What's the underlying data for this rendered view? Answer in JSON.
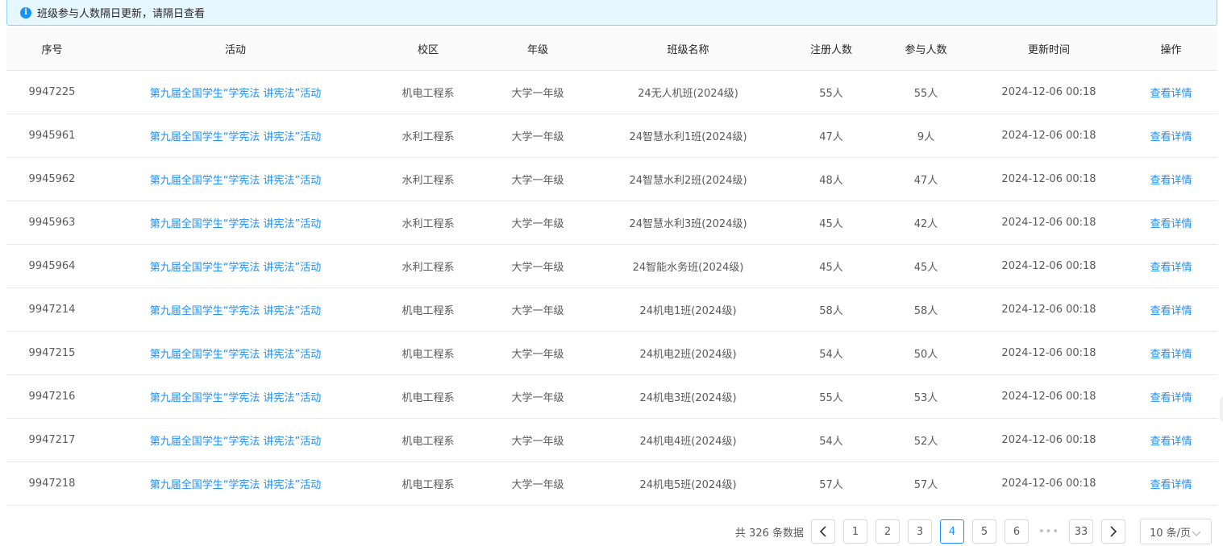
{
  "notice": {
    "text": "班级参与人数隔日更新，请隔日查看"
  },
  "table": {
    "headers": [
      "序号",
      "活动",
      "校区",
      "年级",
      "班级名称",
      "注册人数",
      "参与人数",
      "更新时间",
      "操作"
    ],
    "rows": [
      {
        "id": "9947225",
        "activity": "第九届全国学生“学宪法 讲宪法”活动",
        "campus": "机电工程系",
        "grade": "大学一年级",
        "class_name": "24无人机班(2024级)",
        "registered": "55人",
        "participants": "55人",
        "updated": "2024-12-06 00:18",
        "action": "查看详情"
      },
      {
        "id": "9945961",
        "activity": "第九届全国学生“学宪法 讲宪法”活动",
        "campus": "水利工程系",
        "grade": "大学一年级",
        "class_name": "24智慧水利1班(2024级)",
        "registered": "47人",
        "participants": "9人",
        "updated": "2024-12-06 00:18",
        "action": "查看详情"
      },
      {
        "id": "9945962",
        "activity": "第九届全国学生“学宪法 讲宪法”活动",
        "campus": "水利工程系",
        "grade": "大学一年级",
        "class_name": "24智慧水利2班(2024级)",
        "registered": "48人",
        "participants": "47人",
        "updated": "2024-12-06 00:18",
        "action": "查看详情"
      },
      {
        "id": "9945963",
        "activity": "第九届全国学生“学宪法 讲宪法”活动",
        "campus": "水利工程系",
        "grade": "大学一年级",
        "class_name": "24智慧水利3班(2024级)",
        "registered": "45人",
        "participants": "42人",
        "updated": "2024-12-06 00:18",
        "action": "查看详情"
      },
      {
        "id": "9945964",
        "activity": "第九届全国学生“学宪法 讲宪法”活动",
        "campus": "水利工程系",
        "grade": "大学一年级",
        "class_name": "24智能水务班(2024级)",
        "registered": "45人",
        "participants": "45人",
        "updated": "2024-12-06 00:18",
        "action": "查看详情"
      },
      {
        "id": "9947214",
        "activity": "第九届全国学生“学宪法 讲宪法”活动",
        "campus": "机电工程系",
        "grade": "大学一年级",
        "class_name": "24机电1班(2024级)",
        "registered": "58人",
        "participants": "58人",
        "updated": "2024-12-06 00:18",
        "action": "查看详情"
      },
      {
        "id": "9947215",
        "activity": "第九届全国学生“学宪法 讲宪法”活动",
        "campus": "机电工程系",
        "grade": "大学一年级",
        "class_name": "24机电2班(2024级)",
        "registered": "54人",
        "participants": "50人",
        "updated": "2024-12-06 00:18",
        "action": "查看详情"
      },
      {
        "id": "9947216",
        "activity": "第九届全国学生“学宪法 讲宪法”活动",
        "campus": "机电工程系",
        "grade": "大学一年级",
        "class_name": "24机电3班(2024级)",
        "registered": "55人",
        "participants": "53人",
        "updated": "2024-12-06 00:18",
        "action": "查看详情"
      },
      {
        "id": "9947217",
        "activity": "第九届全国学生“学宪法 讲宪法”活动",
        "campus": "机电工程系",
        "grade": "大学一年级",
        "class_name": "24机电4班(2024级)",
        "registered": "54人",
        "participants": "52人",
        "updated": "2024-12-06 00:18",
        "action": "查看详情"
      },
      {
        "id": "9947218",
        "activity": "第九届全国学生“学宪法 讲宪法”活动",
        "campus": "机电工程系",
        "grade": "大学一年级",
        "class_name": "24机电5班(2024级)",
        "registered": "57人",
        "participants": "57人",
        "updated": "2024-12-06 00:18",
        "action": "查看详情"
      }
    ]
  },
  "pagination": {
    "total_text": "共 326 条数据",
    "pages": [
      "1",
      "2",
      "3",
      "4",
      "5",
      "6"
    ],
    "current": "4",
    "ellipsis": "•••",
    "last": "33",
    "page_size": "10 条/页",
    "prev_icon": "chevron-left-icon",
    "next_icon": "chevron-right-icon"
  },
  "colors": {
    "accent": "#1890ff",
    "notice_bg": "#e6f7ff",
    "notice_border": "#91d5ff",
    "header_bg": "#fafafa",
    "border": "#e8e8e8"
  }
}
